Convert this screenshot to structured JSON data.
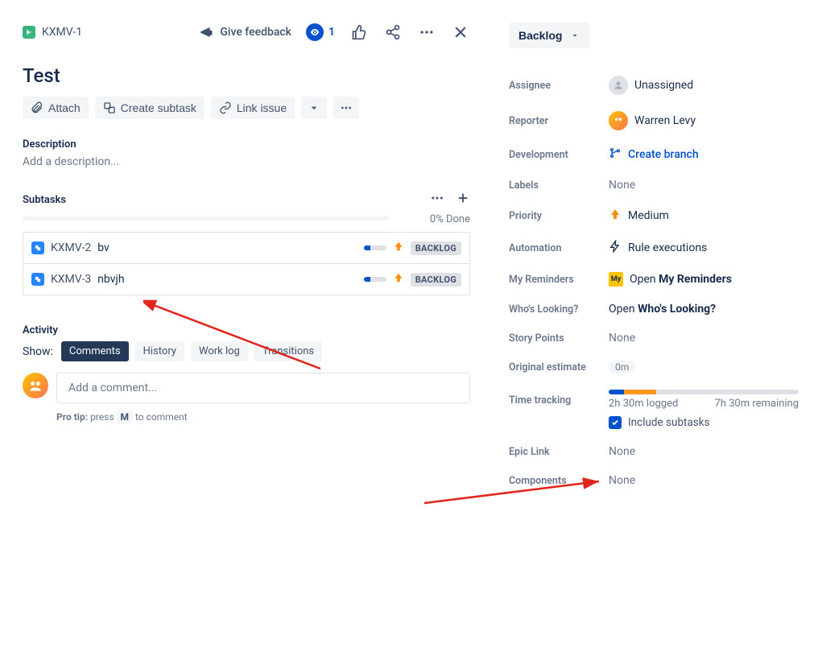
{
  "breadcrumb": {
    "key": "KXMV-1"
  },
  "header": {
    "feedback": "Give feedback",
    "watch_count": "1"
  },
  "issue": {
    "title": "Test",
    "toolbar": {
      "attach": "Attach",
      "create_subtask": "Create subtask",
      "link_issue": "Link issue"
    },
    "description": {
      "label": "Description",
      "placeholder": "Add a description..."
    }
  },
  "subtasks": {
    "label": "Subtasks",
    "progress_text": "0% Done",
    "items": [
      {
        "key": "KXMV-2",
        "summary": "bv",
        "status": "BACKLOG"
      },
      {
        "key": "KXMV-3",
        "summary": "nbvjh",
        "status": "BACKLOG"
      }
    ]
  },
  "activity": {
    "label": "Activity",
    "show": "Show:",
    "tabs": {
      "comments": "Comments",
      "history": "History",
      "worklog": "Work log",
      "transitions": "Transitions"
    },
    "comment_placeholder": "Add a comment...",
    "protip_prefix": "Pro tip:",
    "protip_press": "press",
    "protip_key": "M",
    "protip_suffix": "to comment"
  },
  "side": {
    "status": "Backlog",
    "fields": {
      "assignee": {
        "label": "Assignee",
        "value": "Unassigned"
      },
      "reporter": {
        "label": "Reporter",
        "value": "Warren Levy"
      },
      "development": {
        "label": "Development",
        "link": "Create branch"
      },
      "labels": {
        "label": "Labels",
        "value": "None"
      },
      "priority": {
        "label": "Priority",
        "value": "Medium"
      },
      "automation": {
        "label": "Automation",
        "value": "Rule executions"
      },
      "reminders": {
        "label": "My Reminders",
        "open": "Open",
        "app": "My Reminders"
      },
      "whos_looking": {
        "label": "Who's Looking?",
        "open": "Open",
        "app": "Who's Looking?"
      },
      "story_points": {
        "label": "Story Points",
        "value": "None"
      },
      "original_estimate": {
        "label": "Original estimate",
        "value": "0m"
      },
      "time_tracking": {
        "label": "Time tracking",
        "logged": "2h 30m logged",
        "remaining": "7h 30m remaining",
        "include": "Include subtasks"
      },
      "epic_link": {
        "label": "Epic Link",
        "value": "None"
      },
      "components": {
        "label": "Components",
        "value": "None"
      }
    }
  }
}
